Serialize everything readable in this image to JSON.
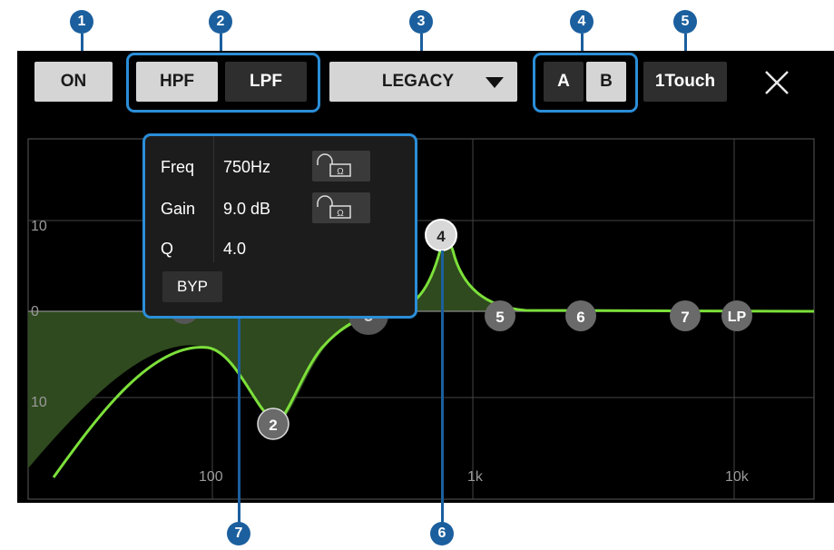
{
  "callouts": [
    "1",
    "2",
    "3",
    "4",
    "5",
    "6",
    "7"
  ],
  "toolbar": {
    "on_label": "ON",
    "hpf_label": "HPF",
    "lpf_label": "LPF",
    "type_label": "LEGACY",
    "a_label": "A",
    "b_label": "B",
    "onetouch_label": "1Touch",
    "close_icon": "close-icon",
    "dropdown_icon": "triangle-down-icon"
  },
  "graph": {
    "y_ticks": [
      "10",
      "0",
      "10"
    ],
    "x_ticks": [
      "100",
      "1k",
      "10k"
    ],
    "band_nodes": [
      "HP",
      "2",
      "3",
      "4",
      "5",
      "6",
      "7",
      "LP"
    ]
  },
  "params": {
    "freq_label": "Freq",
    "freq_value": "750Hz",
    "gain_label": "Gain",
    "gain_value": "9.0 dB",
    "q_label": "Q",
    "q_value": "4.0",
    "byp_label": "BYP",
    "lock_icon": "padlock-icon"
  },
  "colors": {
    "accent": "#2b8ed8",
    "callout": "#1b5f9e",
    "curve": "#7ce03a",
    "fill": "#2f4a1e"
  }
}
